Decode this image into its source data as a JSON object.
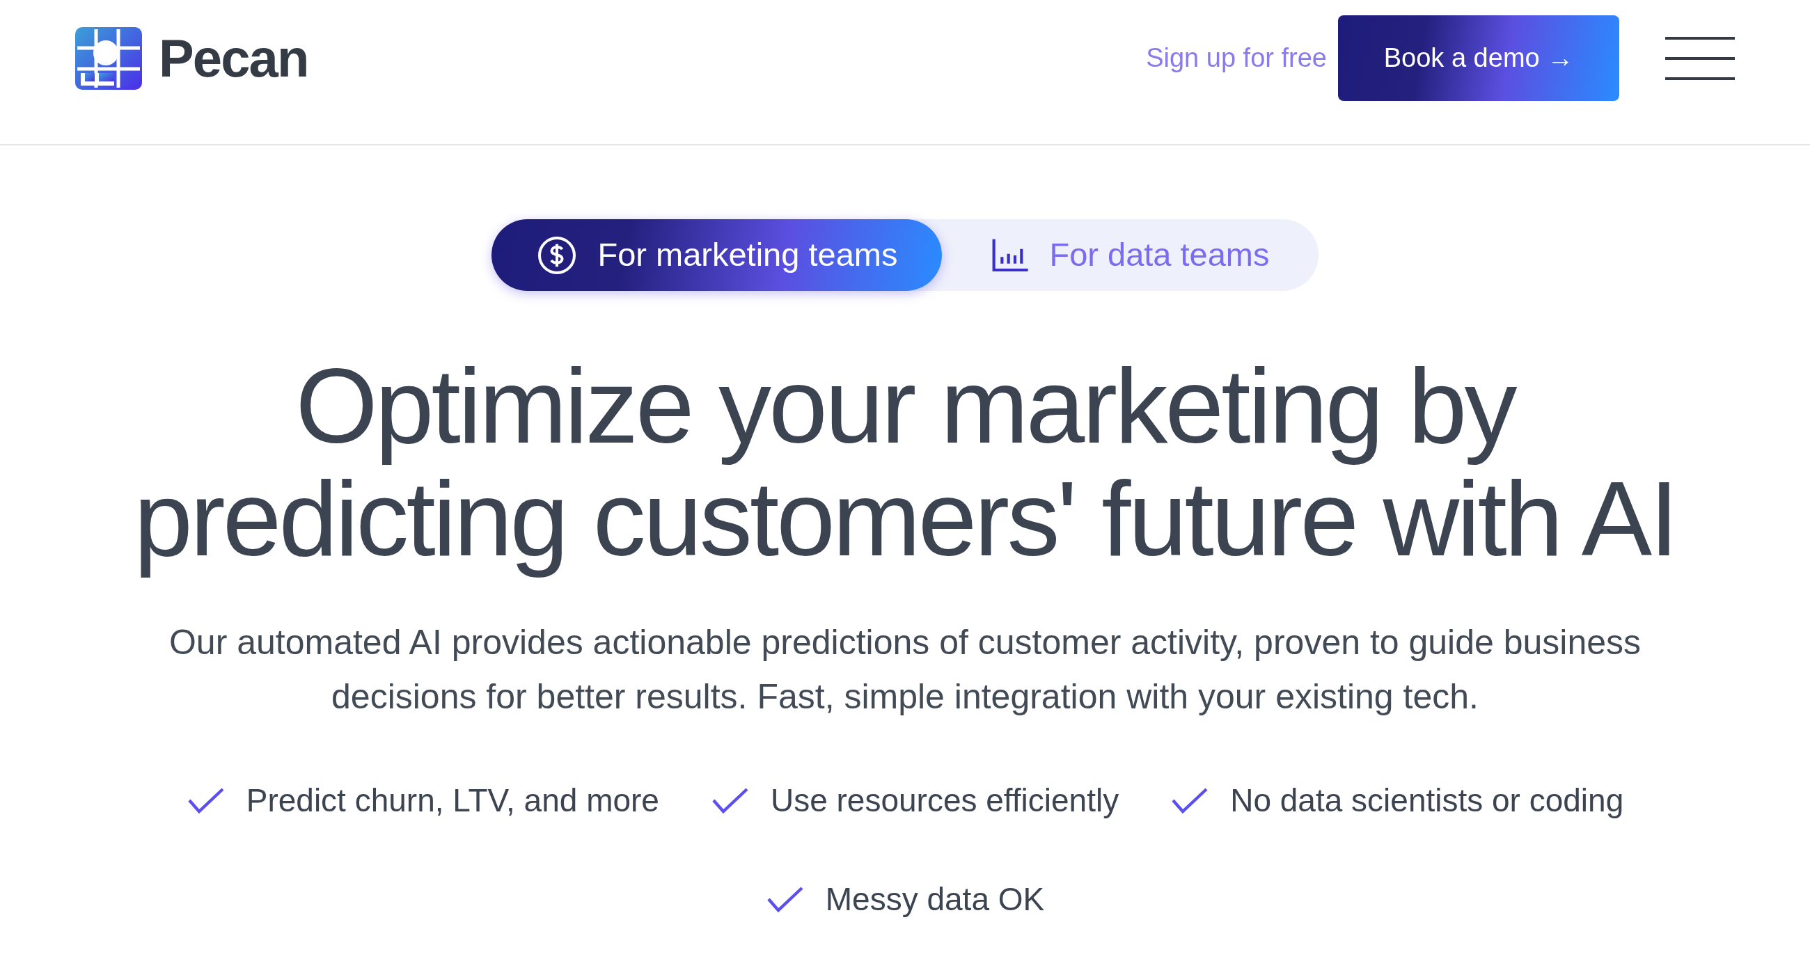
{
  "header": {
    "brand": "Pecan",
    "signup_link": "Sign up for free",
    "cta_button": "Book a demo →"
  },
  "tabs": [
    {
      "label": "For marketing teams",
      "kind": "dollar",
      "selected": true
    },
    {
      "label": "For data teams",
      "kind": "chart",
      "selected": false
    }
  ],
  "hero": {
    "heading_lines": [
      "Optimize your marketing by",
      "predicting customers' future with AI"
    ],
    "description": "Our automated AI provides actionable predictions of customer activity, proven to guide business decisions for better results. Fast, simple integration with your existing tech."
  },
  "features": [
    "Predict churn, LTV, and more",
    "Use resources efficiently",
    "No data scientists or coding",
    "Messy data OK"
  ]
}
